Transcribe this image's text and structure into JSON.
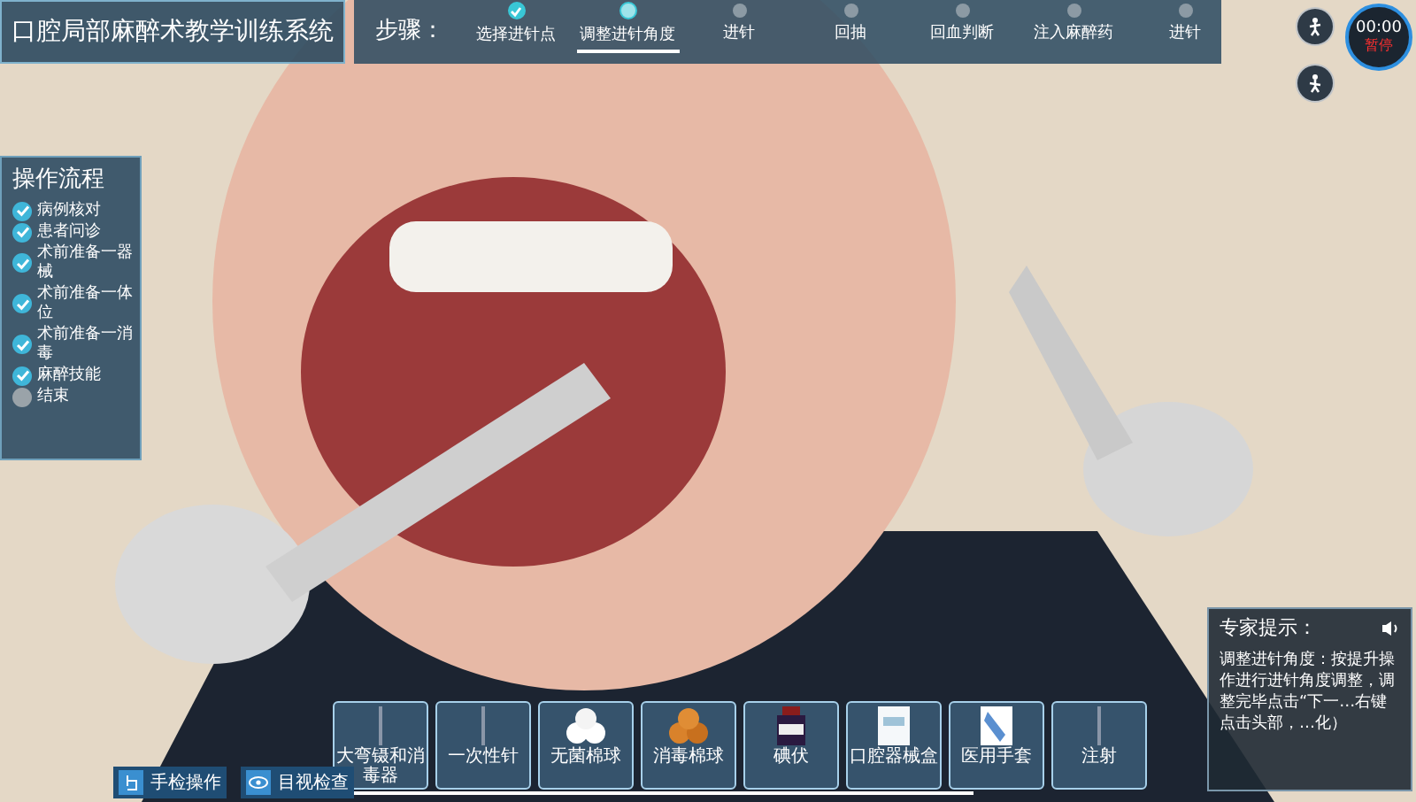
{
  "app_title": "口腔局部麻醉术教学训练系统",
  "steps": {
    "label": "步骤：",
    "items": [
      {
        "label": "选择进针点",
        "done": true,
        "selected": false
      },
      {
        "label": "调整进针角度",
        "done": false,
        "selected": true
      },
      {
        "label": "进针",
        "done": false,
        "selected": false
      },
      {
        "label": "回抽",
        "done": false,
        "selected": false
      },
      {
        "label": "回血判断",
        "done": false,
        "selected": false
      },
      {
        "label": "注入麻醉药",
        "done": false,
        "selected": false
      },
      {
        "label": "进针",
        "done": false,
        "selected": false
      }
    ]
  },
  "timer": {
    "time": "00:00",
    "action": "暂停"
  },
  "procedure": {
    "title": "操作流程",
    "items": [
      {
        "label": "病例核对",
        "checked": true
      },
      {
        "label": "患者问诊",
        "checked": true
      },
      {
        "label": "术前准备一器械",
        "checked": true
      },
      {
        "label": "术前准备一体位",
        "checked": true
      },
      {
        "label": "术前准备一消毒",
        "checked": true
      },
      {
        "label": "麻醉技能",
        "checked": true
      },
      {
        "label": "结束",
        "checked": false
      }
    ]
  },
  "tools": [
    {
      "label": "大弯镊和消毒器",
      "kind": "instrument"
    },
    {
      "label": "一次性针",
      "kind": "instrument"
    },
    {
      "label": "无菌棉球",
      "kind": "cotton"
    },
    {
      "label": "消毒棉球",
      "kind": "iodine-cotton"
    },
    {
      "label": "碘伏",
      "kind": "bottle"
    },
    {
      "label": "口腔器械盒",
      "kind": "box"
    },
    {
      "label": "医用手套",
      "kind": "glove"
    },
    {
      "label": "注射",
      "kind": "instrument"
    }
  ],
  "bottom_buttons": [
    {
      "label": "手检操作"
    },
    {
      "label": "目视检查"
    }
  ],
  "expert_tip": {
    "title": "专家提示：",
    "text": "调整进针角度：按提升操作进行进针角度调整，调整完毕点击“下一…右键点击头部，…化）"
  }
}
